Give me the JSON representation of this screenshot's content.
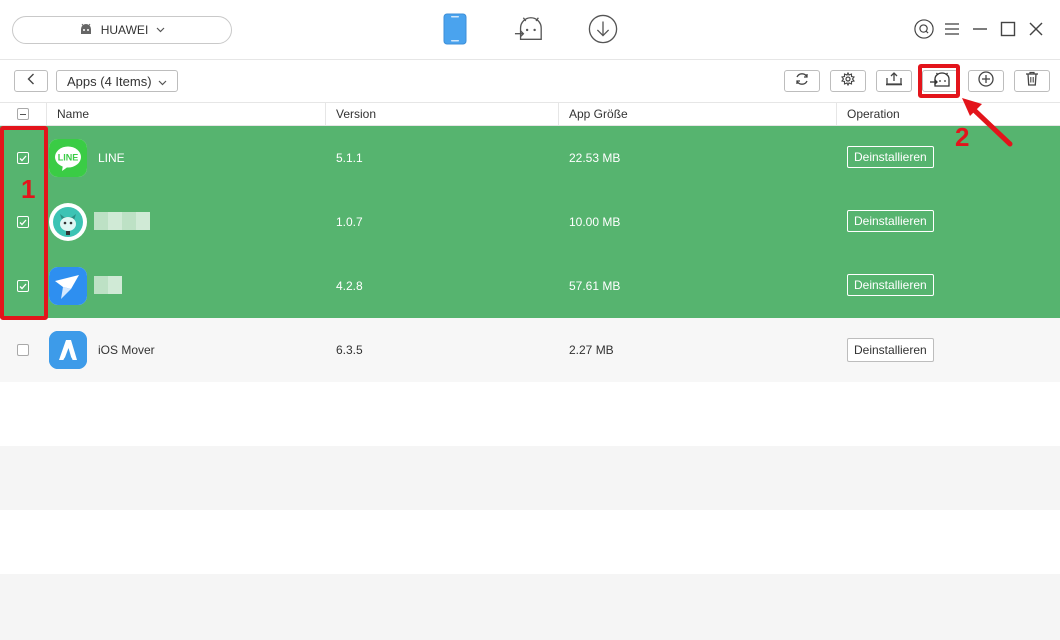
{
  "device": {
    "name": "HUAWEI"
  },
  "toolbar": {
    "category_label": "Apps (4 Items)"
  },
  "table": {
    "columns": [
      "Name",
      "Version",
      "App Größe",
      "Operation"
    ],
    "rows": [
      {
        "name": "LINE",
        "version": "5.1.1",
        "size": "22.53 MB",
        "action": "Deinstallieren",
        "selected": true
      },
      {
        "name": "",
        "version": "1.0.7",
        "size": "10.00 MB",
        "action": "Deinstallieren",
        "selected": true
      },
      {
        "name": "",
        "version": "4.2.8",
        "size": "57.61 MB",
        "action": "Deinstallieren",
        "selected": true
      },
      {
        "name": "iOS Mover",
        "version": "6.3.5",
        "size": "2.27 MB",
        "action": "Deinstallieren",
        "selected": false
      }
    ]
  },
  "annotations": {
    "step1": "1",
    "step2": "2"
  },
  "colors": {
    "selected_row": "#56b46f",
    "accent_blue": "#3d9be9",
    "annotation_red": "#e3141b"
  },
  "icons": {
    "top_nav": [
      "phone-icon",
      "android-transfer-icon",
      "download-icon"
    ],
    "window": [
      "search-icon",
      "menu-icon",
      "minimize-icon",
      "maximize-icon",
      "close-icon"
    ],
    "toolbar": [
      "back-icon",
      "refresh-icon",
      "settings-icon",
      "export-to-computer-icon",
      "transfer-to-device-icon",
      "add-icon",
      "delete-icon"
    ]
  }
}
